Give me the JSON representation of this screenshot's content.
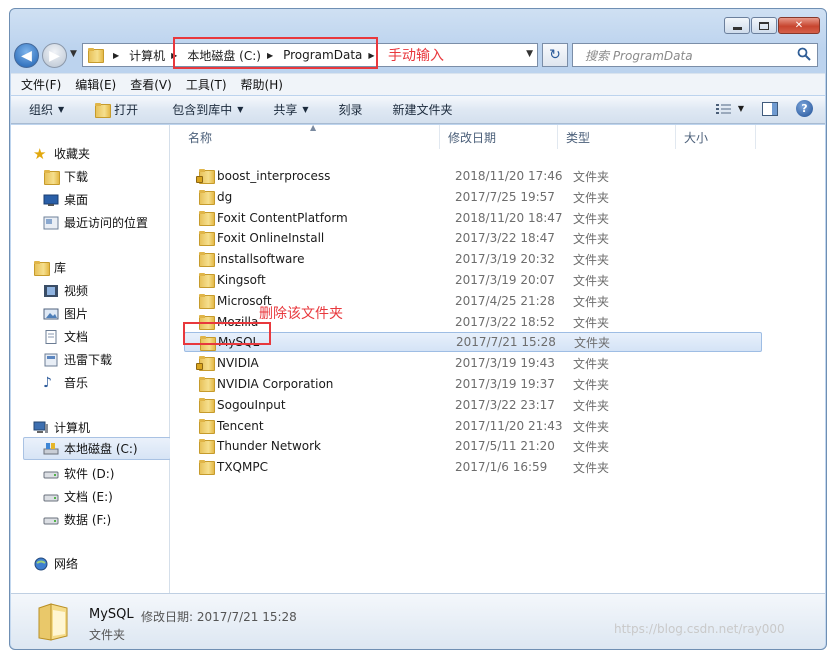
{
  "window": {
    "caption_buttons": {
      "minimize": "",
      "maximize": "",
      "close": "✕"
    }
  },
  "nav": {
    "address_crumbs": [
      "计算机",
      "本地磁盘 (C:)",
      "ProgramData"
    ],
    "search_placeholder": "搜索 ProgramData"
  },
  "annotations": {
    "address_note": "手动输入",
    "delete_note": "删除该文件夹"
  },
  "menu": [
    "文件(F)",
    "编辑(E)",
    "查看(V)",
    "工具(T)",
    "帮助(H)"
  ],
  "toolbar": {
    "organize": "组织",
    "open": "打开",
    "include_in_library": "包含到库中",
    "share": "共享",
    "burn": "刻录",
    "new_folder": "新建文件夹",
    "help": "?"
  },
  "sidebar": {
    "favorites": {
      "label": "收藏夹",
      "items": [
        "下载",
        "桌面",
        "最近访问的位置"
      ]
    },
    "libraries": {
      "label": "库",
      "items": [
        "视频",
        "图片",
        "文档",
        "迅雷下载",
        "音乐"
      ]
    },
    "computer": {
      "label": "计算机",
      "items": [
        "本地磁盘 (C:)",
        "软件 (D:)",
        "文档 (E:)",
        "数据 (F:)"
      ]
    },
    "network": {
      "label": "网络"
    }
  },
  "columns": {
    "name": "名称",
    "date": "修改日期",
    "type": "类型",
    "size": "大小"
  },
  "files": [
    {
      "name": "boost_interprocess",
      "date": "2018/11/20 17:46",
      "type": "文件夹"
    },
    {
      "name": "dg",
      "date": "2017/7/25 19:57",
      "type": "文件夹"
    },
    {
      "name": "Foxit ContentPlatform",
      "date": "2018/11/20 18:47",
      "type": "文件夹"
    },
    {
      "name": "Foxit OnlineInstall",
      "date": "2017/3/22 18:47",
      "type": "文件夹"
    },
    {
      "name": "installsoftware",
      "date": "2017/3/19 20:32",
      "type": "文件夹"
    },
    {
      "name": "Kingsoft",
      "date": "2017/3/19 20:07",
      "type": "文件夹"
    },
    {
      "name": "Microsoft",
      "date": "2017/4/25 21:28",
      "type": "文件夹"
    },
    {
      "name": "Mozilla",
      "date": "2017/3/22 18:52",
      "type": "文件夹"
    },
    {
      "name": "MySQL",
      "date": "2017/7/21 15:28",
      "type": "文件夹"
    },
    {
      "name": "NVIDIA",
      "date": "2017/3/19 19:43",
      "type": "文件夹"
    },
    {
      "name": "NVIDIA Corporation",
      "date": "2017/3/19 19:37",
      "type": "文件夹"
    },
    {
      "name": "SogouInput",
      "date": "2017/3/22 23:17",
      "type": "文件夹"
    },
    {
      "name": "Tencent",
      "date": "2017/11/20 21:43",
      "type": "文件夹"
    },
    {
      "name": "Thunder Network",
      "date": "2017/5/11 21:20",
      "type": "文件夹"
    },
    {
      "name": "TXQMPC",
      "date": "2017/1/6 16:59",
      "type": "文件夹"
    }
  ],
  "details": {
    "name": "MySQL",
    "modified": "修改日期: 2017/7/21 15:28",
    "type": "文件夹"
  },
  "watermark": "https://blog.csdn.net/ray000"
}
